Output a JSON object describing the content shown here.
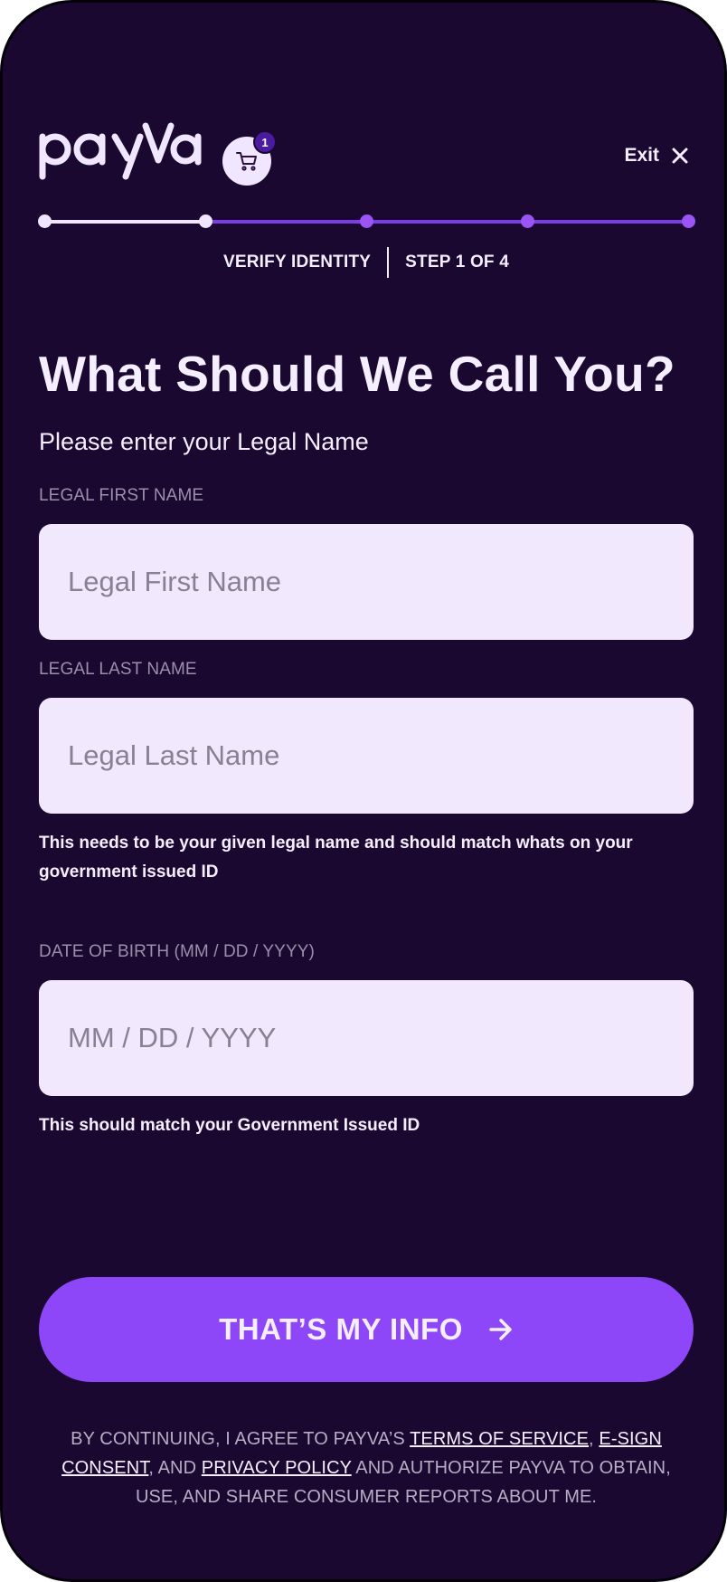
{
  "header": {
    "brand": "payva",
    "cart_count": "1",
    "exit_label": "Exit"
  },
  "progress": {
    "step_title": "VERIFY IDENTITY",
    "step_counter": "STEP 1 OF 4",
    "completed_fraction": 0.25,
    "colors": {
      "done": "#efe6ff",
      "pending": "#7b3ee6"
    }
  },
  "main": {
    "title": "What Should We Call You?",
    "subtitle": "Please enter your Legal Name",
    "first_name": {
      "label": "LEGAL FIRST NAME",
      "placeholder": "Legal First Name",
      "value": ""
    },
    "last_name": {
      "label": "LEGAL LAST NAME",
      "placeholder": "Legal Last Name",
      "value": ""
    },
    "name_helper": "This needs to be your given legal name and should match whats on your government issued ID",
    "dob": {
      "label": "DATE OF BIRTH (MM / DD / YYYY)",
      "placeholder": "MM / DD / YYYY",
      "value": ""
    },
    "dob_helper": "This should match your Government Issued ID"
  },
  "submit": {
    "label": "THAT’S MY INFO",
    "icon": "arrow-right-icon"
  },
  "legal": {
    "prefix": "BY CONTINUING, I AGREE TO PAYVA’S ",
    "terms_link": "TERMS OF SERVICE",
    "comma": ", ",
    "esign_link": "E-SIGN CONSENT",
    "and": ", AND ",
    "privacy_link": "PRIVACY POLICY",
    "suffix": " AND AUTHORIZE PAYVA TO OBTAIN, USE, AND SHARE CONSUMER REPORTS ABOUT ME."
  },
  "colors": {
    "background": "#1a0830",
    "accent": "#8d47f8",
    "input_bg": "#f1e8fe",
    "text": "#f4eefe",
    "label": "#9b8faa"
  }
}
